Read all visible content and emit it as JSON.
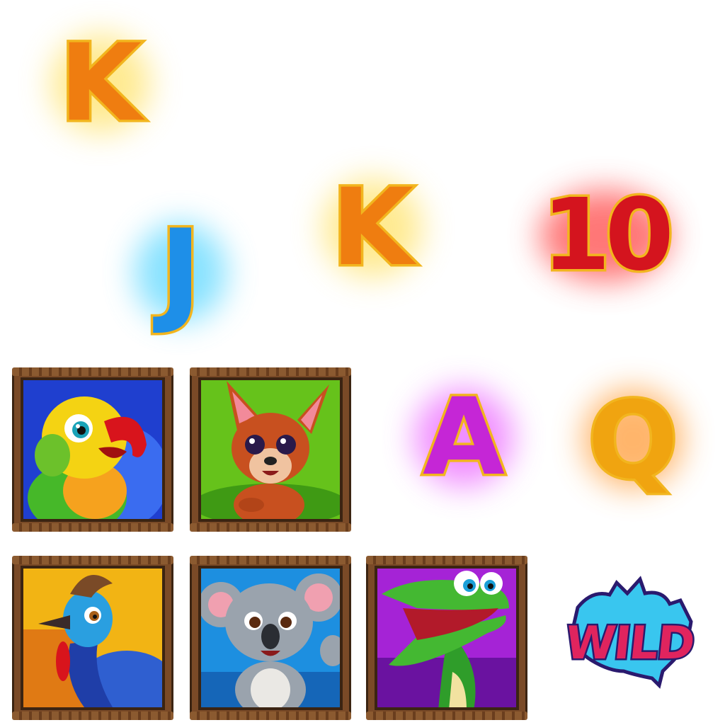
{
  "symbols": {
    "k_top": {
      "label": "K",
      "color": "#ef7d10"
    },
    "j": {
      "label": "J",
      "color": "#1e8fe8"
    },
    "k_mid": {
      "label": "K",
      "color": "#ef7d10"
    },
    "ten": {
      "label": "10",
      "color": "#d4141e"
    },
    "a": {
      "label": "A",
      "color": "#c526d6"
    },
    "q": {
      "label": "Q",
      "color": "#f0a410"
    }
  },
  "tiles": [
    {
      "name": "parrot-tile",
      "animal": "parrot",
      "bg": "#1f3fcf"
    },
    {
      "name": "kangaroo-tile",
      "animal": "kangaroo",
      "bg": "#66c21b"
    },
    {
      "name": "cassowary-tile",
      "animal": "cassowary",
      "bg": "#f2b414"
    },
    {
      "name": "koala-tile",
      "animal": "koala",
      "bg": "#1d8fe0"
    },
    {
      "name": "crocodile-tile",
      "animal": "crocodile",
      "bg": "#a523d6"
    }
  ],
  "wild": {
    "label": "WILD",
    "map_color": "#39c6ef"
  }
}
